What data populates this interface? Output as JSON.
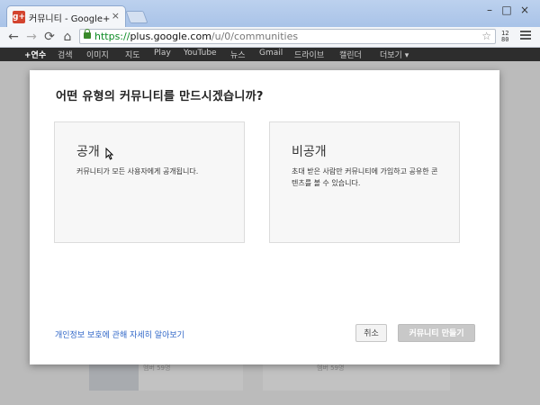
{
  "browser": {
    "tab_title": "커뮤니티 - Google+",
    "tab_favicon": "g+",
    "close_tab": "×",
    "url_scheme": "https://",
    "url_host": "plus.google.com",
    "url_path": "/u/0/communities",
    "window_min": "–",
    "window_max": "□",
    "window_close": "×",
    "back": "←",
    "forward": "→",
    "reload": "⟳",
    "home": "⌂",
    "star": "☆",
    "ext_top": "12",
    "ext_bottom": "80"
  },
  "google_bar": {
    "items": [
      "+연수",
      "검색",
      "이미지",
      "지도",
      "Play",
      "YouTube",
      "뉴스",
      "Gmail",
      "드라이브",
      "캘린더",
      "더보기 ▾"
    ]
  },
  "background": {
    "card1_text": "멤버 59명",
    "card2_text": "멤버 59명"
  },
  "dialog": {
    "title": "어떤 유형의 커뮤니티를 만드시겠습니까?",
    "public": {
      "title": "공개",
      "description": "커뮤니티가 모든 사용자에게 공개됩니다."
    },
    "private": {
      "title": "비공개",
      "description": "초대 받은 사람만 커뮤니티에 가입하고 공유한 콘텐츠를 볼 수 있습니다."
    },
    "privacy_link": "개인정보 보호에 관해 자세히 알아보기",
    "cancel_label": "취소",
    "create_label": "커뮤니티 만들기"
  },
  "colors": {
    "link": "#2f66c7",
    "google_bar": "#2d2d2d",
    "disabled_button": "#c8c8c8"
  }
}
